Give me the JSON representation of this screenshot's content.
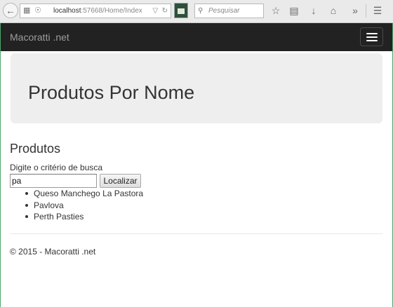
{
  "browser": {
    "url_host": "localhost",
    "url_path": ":57668/Home/Index",
    "search_placeholder": "Pesquisar"
  },
  "navbar": {
    "brand": "Macoratti .net"
  },
  "jumbotron": {
    "title": "Produtos Por Nome"
  },
  "main": {
    "section_title": "Produtos",
    "search_label": "Digite o critério de busca",
    "search_value": "pa",
    "search_button": "Localizar",
    "results": [
      "Queso Manchego La Pastora",
      "Pavlova",
      "Perth Pasties"
    ]
  },
  "footer": {
    "text": "© 2015 - Macoratti .net"
  },
  "colors": {
    "navbar_bg": "#222222",
    "jumbotron_bg": "#eeeeee",
    "window_frame": "#4fa56f"
  }
}
